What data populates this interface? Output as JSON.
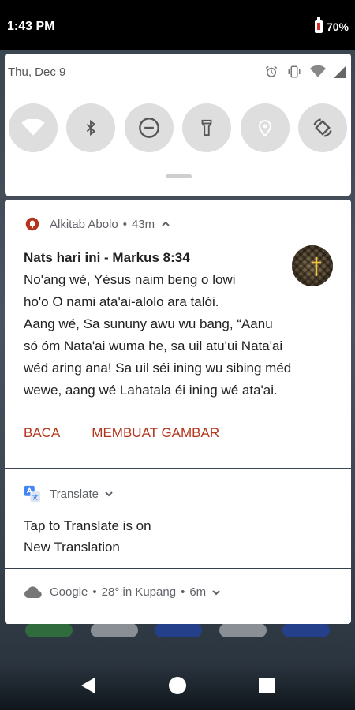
{
  "status_bar": {
    "time": "1:43 PM",
    "battery": "70%"
  },
  "quick_settings": {
    "date": "Thu, Dec 9",
    "tiles": [
      {
        "icon": "wifi-icon",
        "active": true
      },
      {
        "icon": "bluetooth-icon",
        "active": false
      },
      {
        "icon": "do-not-disturb-icon",
        "active": false
      },
      {
        "icon": "flashlight-icon",
        "active": false
      },
      {
        "icon": "location-icon",
        "active": true
      },
      {
        "icon": "auto-rotate-icon",
        "active": false
      }
    ],
    "status_icons": [
      "alarm-icon",
      "vibrate-icon",
      "wifi-icon",
      "signal-icon"
    ]
  },
  "notifications": {
    "alkitab": {
      "app_name": "Alkitab Abolo",
      "time": "43m",
      "title": "Nats hari ini - Markus 8:34",
      "body_lines": [
        "No'ang wé, Yésus naim beng o lowi",
        "ho'o O nami ata'ai-alolo ara talói.",
        "Aang wé, Sa sununy awu wu bang, “Aanu",
        "só óm Nata'ai wuma he, sa uil atu'ui Nata'ai",
        "wéd aring ana! Sa uil séi ining wu sibing méd",
        "wewe, aang wé Lahatala éi ining wé ata'ai."
      ],
      "action_read": "BACA",
      "action_image": "MEMBUAT GAMBAR",
      "accent": "#b3341b"
    },
    "translate": {
      "app_name": "Translate",
      "title": "Tap to Translate is on",
      "subtitle": "New Translation"
    },
    "google": {
      "app_name": "Google",
      "info": "28° in Kupang",
      "time": "6m"
    }
  },
  "colors": {
    "tile_active": "#0b7d6c",
    "tile_inactive": "#dedede"
  }
}
